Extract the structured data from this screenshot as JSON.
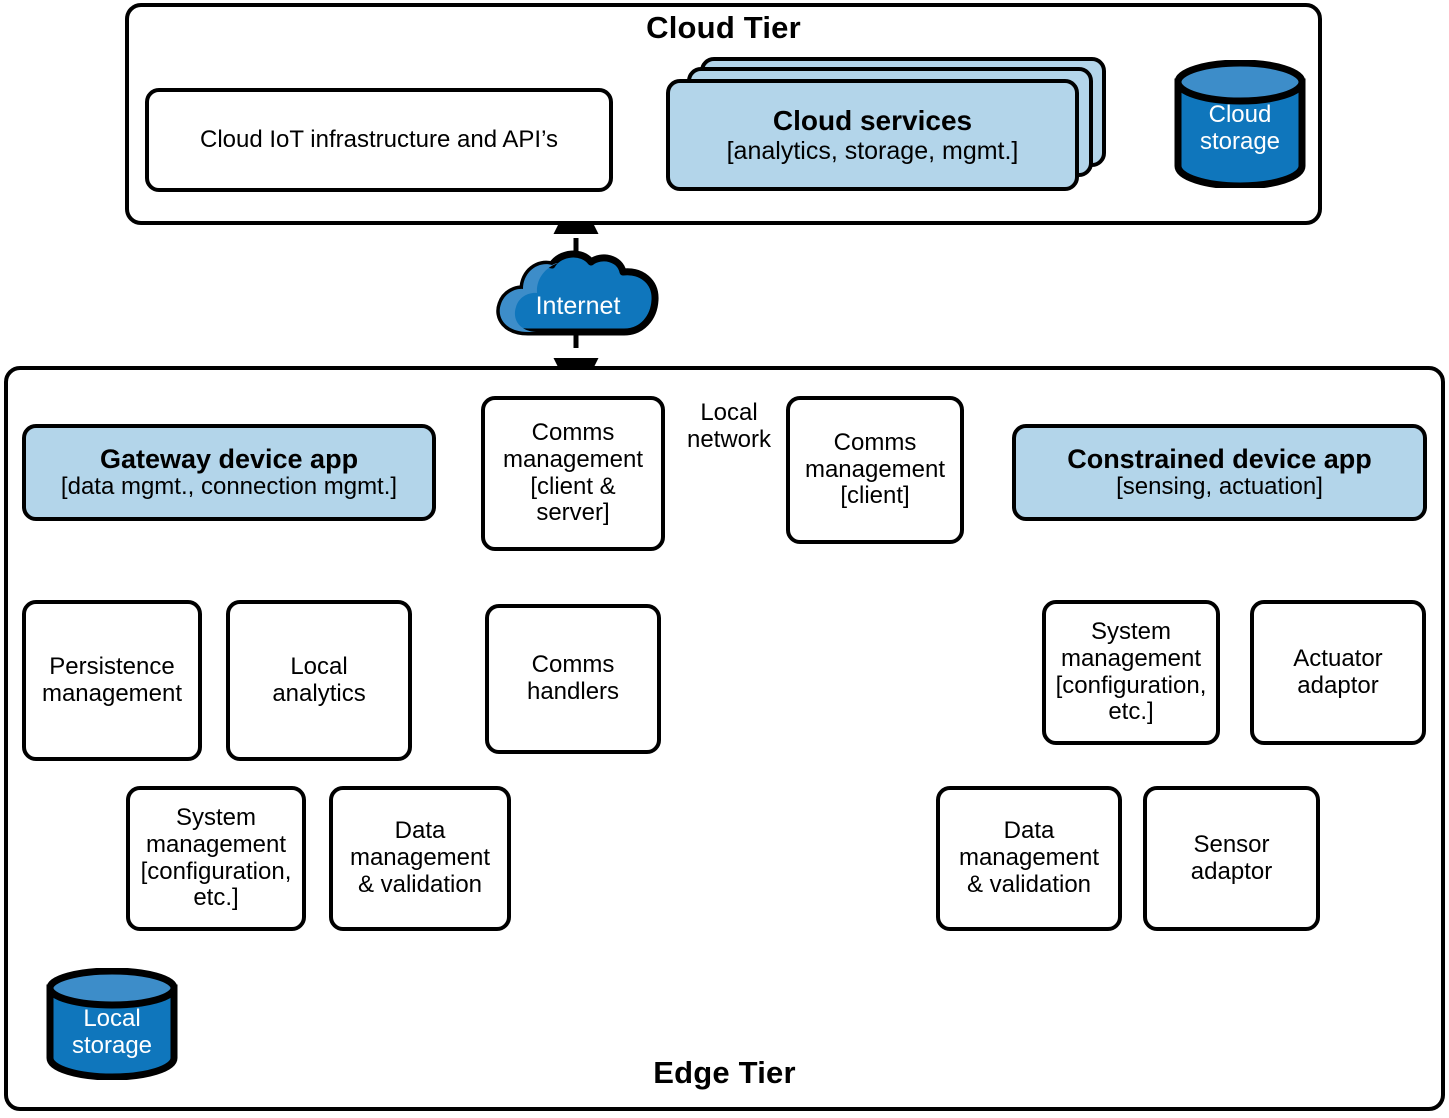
{
  "diagram": {
    "cloud_tier": {
      "title": "Cloud Tier",
      "nodes": {
        "cloud_iot": {
          "label": "Cloud IoT infrastructure and API’s"
        },
        "cloud_services": {
          "title": "Cloud services",
          "subtitle": "[analytics, storage, mgmt.]"
        },
        "cloud_storage": {
          "line1": "Cloud",
          "line2": "storage"
        }
      }
    },
    "internet": {
      "label": "Internet"
    },
    "edge_tier": {
      "title": "Edge Tier",
      "nodes": {
        "gateway_app": {
          "title": "Gateway device app",
          "subtitle": "[data mgmt., connection mgmt.]"
        },
        "gw_persistence": {
          "line1": "Persistence",
          "line2": "management"
        },
        "gw_local_analytics": {
          "line1": "Local",
          "line2": "analytics"
        },
        "gw_system_mgmt": {
          "line1": "System",
          "line2": "management",
          "line3": "[configuration,",
          "line4": "etc.]"
        },
        "gw_data_mgmt": {
          "line1": "Data",
          "line2": "management",
          "line3": "& validation"
        },
        "gw_comms_mgmt": {
          "line1": "Comms",
          "line2": "management",
          "line3": "[client &",
          "line4": "server]"
        },
        "gw_comms_handlers": {
          "line1": "Comms",
          "line2": "handlers"
        },
        "local_storage": {
          "line1": "Local",
          "line2": "storage"
        },
        "cd_comms_mgmt": {
          "line1": "Comms",
          "line2": "management",
          "line3": "[client]"
        },
        "constrained_app": {
          "title": "Constrained device app",
          "subtitle": "[sensing, actuation]"
        },
        "cd_system_mgmt": {
          "line1": "System",
          "line2": "management",
          "line3": "[configuration,",
          "line4": "etc.]"
        },
        "cd_actuator": {
          "line1": "Actuator",
          "line2": "adaptor"
        },
        "cd_data_mgmt": {
          "line1": "Data",
          "line2": "management",
          "line3": "& validation"
        },
        "cd_sensor": {
          "line1": "Sensor",
          "line2": "adaptor"
        }
      },
      "labels": {
        "local_network": {
          "line1": "Local",
          "line2": "network"
        }
      }
    },
    "colors": {
      "accent_fill": "#b3d5ea",
      "cylinder_body": "#0f76bc",
      "cylinder_top": "#3d8dc9",
      "cloud_body": "#0f76bc",
      "cloud_highlight": "#3d8dc9",
      "stroke": "#000000",
      "background": "#ffffff"
    }
  }
}
